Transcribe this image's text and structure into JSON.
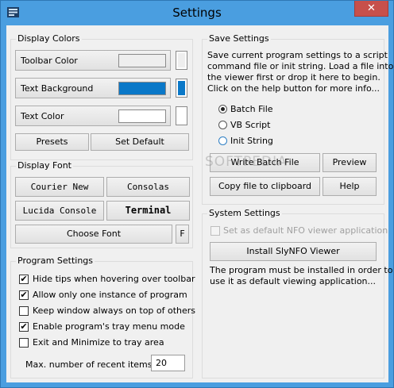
{
  "window": {
    "title": "Settings",
    "close_glyph": "✕"
  },
  "colors": {
    "toolbar_color_swatch": "#eeeeee",
    "text_background_swatch": "#0a78c8",
    "text_color_swatch": "#ffffff",
    "title_bar": "#4a9ee0"
  },
  "display_colors": {
    "title": "Display Colors",
    "toolbar_color": "Toolbar Color",
    "text_background": "Text Background",
    "text_color": "Text Color",
    "presets": "Presets",
    "set_default": "Set Default"
  },
  "display_font": {
    "title": "Display Font",
    "fonts": [
      "Courier New",
      "Consolas",
      "Lucida Console",
      "Terminal"
    ],
    "choose_font": "Choose Font",
    "f_button": "F"
  },
  "program_settings": {
    "title": "Program Settings",
    "options": [
      {
        "label": "Hide tips when hovering over toolbar",
        "checked": true
      },
      {
        "label": "Allow only one instance of program",
        "checked": true
      },
      {
        "label": "Keep window always on top of others",
        "checked": false
      },
      {
        "label": "Enable program's tray menu mode",
        "checked": true
      },
      {
        "label": "Exit and Minimize to tray area",
        "checked": false
      }
    ],
    "recent_label": "Max. number of recent items:",
    "recent_value": "20"
  },
  "save_settings": {
    "title": "Save Settings",
    "description": [
      "Save current program settings to a script",
      "command file or init string. Load a file into",
      "the viewer first or drop it here to begin.",
      "Click on the help button for more info..."
    ],
    "radios": [
      {
        "label": "Batch File",
        "checked": true
      },
      {
        "label": "VB Script",
        "checked": false
      },
      {
        "label": "Init String",
        "checked": false
      }
    ],
    "write_batch": "Write Batch File",
    "preview": "Preview",
    "copy_clipboard": "Copy file to clipboard",
    "help": "Help"
  },
  "system_settings": {
    "title": "System Settings",
    "default_viewer": "Set as default NFO viewer application",
    "install_button": "Install SlyNFO Viewer",
    "note": [
      "The program must be installed in order to",
      "use it as default viewing application..."
    ]
  },
  "watermark": "SOFTPEDIA"
}
